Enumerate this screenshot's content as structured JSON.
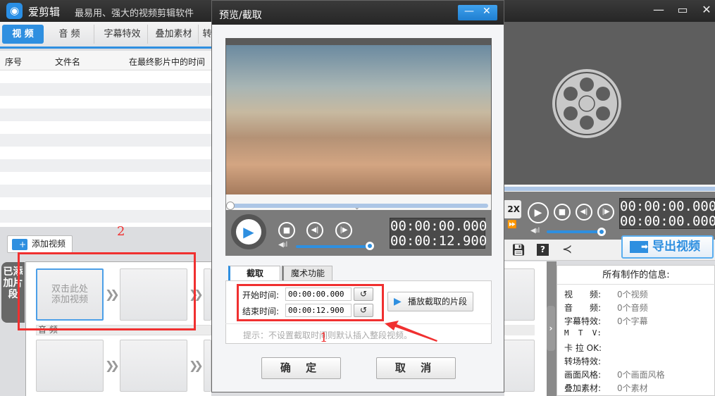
{
  "app": {
    "title": "爱剪辑",
    "subtitle": "最易用、强大的视频剪辑软件",
    "window_controls": [
      "minimize-icon",
      "restore-icon",
      "close-icon"
    ]
  },
  "tabs": [
    {
      "label": "视 频",
      "active": true
    },
    {
      "label": "音 频"
    },
    {
      "label": "字幕特效"
    },
    {
      "label": "叠加素材"
    },
    {
      "label": "转"
    }
  ],
  "table": {
    "columns": [
      "序号",
      "文件名",
      "在最终影片中的时间"
    ]
  },
  "clips": {
    "add_button": "添加视频",
    "side_tab": "已添加片段",
    "placeholder": "双击此处\n添加视频",
    "audio_label": "音 频"
  },
  "annotations": {
    "box1_label": "1",
    "box2_label": "2",
    "color": "#f03030"
  },
  "dialog": {
    "title": "预览/截取",
    "current_time": "00:00:00.000",
    "total_time": "00:00:12.900",
    "volume": 1.0,
    "progress": 0.0,
    "tabs": [
      {
        "label": "截取",
        "active": true
      },
      {
        "label": "魔术功能"
      }
    ],
    "start_label": "开始时间:",
    "start_value": "00:00:00.000",
    "end_label": "结束时间:",
    "end_value": "00:00:12.900",
    "play_clip": "播放截取的片段",
    "hint": "提示：不设置截取时间则默认插入整段视频。",
    "ok": "确 定",
    "cancel": "取 消"
  },
  "preview": {
    "current_time": "00:00:00.000",
    "total_time": "00:00:00.000",
    "speed": "2X",
    "volume": 1.0,
    "export": "导出视频"
  },
  "info": {
    "title": "所有制作的信息:",
    "rows": [
      {
        "k": "视　　频:",
        "v": "0个视频"
      },
      {
        "k": "音　　频:",
        "v": "0个音频"
      },
      {
        "k": "字幕特效:",
        "v": "0个字幕"
      },
      {
        "k": "M  T  V:",
        "v": ""
      },
      {
        "k": "卡 拉 OK:",
        "v": ""
      },
      {
        "k": "转场特效:",
        "v": ""
      },
      {
        "k": "画面风格:",
        "v": "0个画面风格"
      },
      {
        "k": "叠加素材:",
        "v": "0个素材"
      }
    ]
  },
  "colors": {
    "accent": "#2e8fe0",
    "titlebar": "#2b2b2b"
  }
}
